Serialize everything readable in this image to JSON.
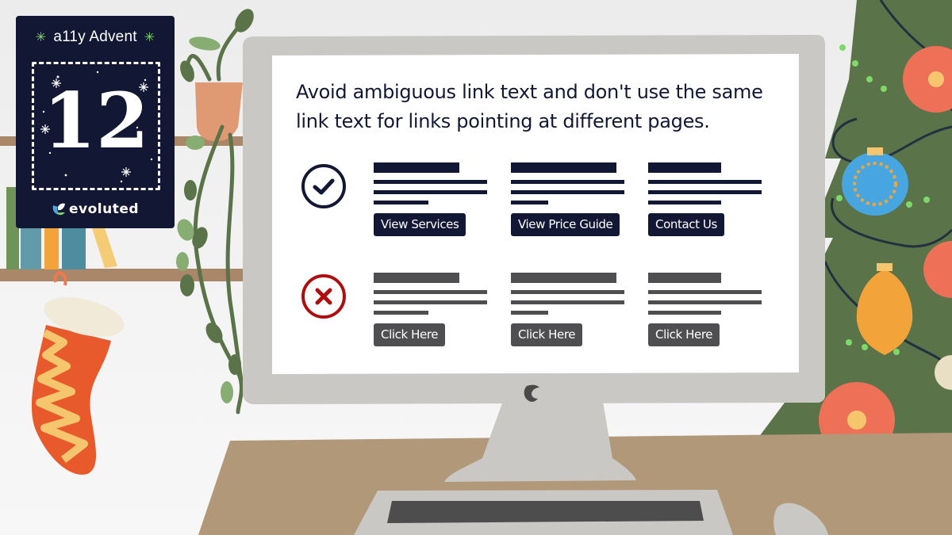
{
  "advent": {
    "series_title": "a11y Advent",
    "day": "12",
    "brand": "evoluted",
    "spark_icon": "asterisk-sparkle"
  },
  "screen": {
    "headline_line1": "Avoid ambiguous link text and don't use the same",
    "headline_line2": "link text for links pointing at different pages.",
    "good_example": {
      "icon": "check-circle-icon",
      "color": "#121833",
      "links": [
        "View Services",
        "View Price Guide",
        "Contact Us"
      ]
    },
    "bad_example": {
      "icon": "x-circle-icon",
      "color": "#4f4f52",
      "icon_color": "#b00e0e",
      "links": [
        "Click Here",
        "Click Here",
        "Click Here"
      ]
    }
  },
  "colors": {
    "navy": "#121833",
    "monitor_grey": "#c9c8c5",
    "desk": "#b09878",
    "tree_green": "#5a7348",
    "stocking_red": "#e85a2c",
    "stocking_yellow": "#f6c66e"
  }
}
